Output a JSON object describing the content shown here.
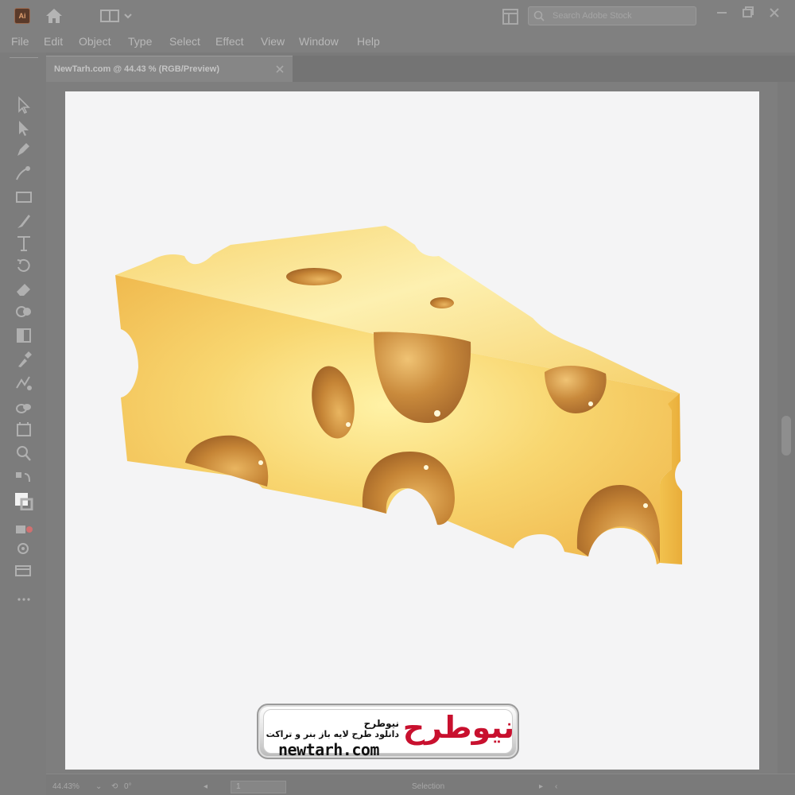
{
  "titlebar": {
    "app_badge": "Ai",
    "search_placeholder": "Search Adobe Stock"
  },
  "menu": [
    "File",
    "Edit",
    "Object",
    "Type",
    "Select",
    "Effect",
    "View",
    "Window",
    "Help"
  ],
  "document_tab": {
    "label": "NewTarh.com @ 44.43 % (RGB/Preview)"
  },
  "tools": [
    "selection-tool-icon",
    "direct-selection-tool-icon",
    "pen-tool-icon",
    "curvature-tool-icon",
    "rectangle-tool-icon",
    "paintbrush-tool-icon",
    "type-tool-icon",
    "rotate-tool-icon",
    "eraser-tool-icon",
    "shape-builder-tool-icon",
    "gradient-tool-icon",
    "eyedropper-tool-icon",
    "blend-tool-icon",
    "symbol-sprayer-tool-icon",
    "artboard-tool-icon",
    "zoom-tool-icon",
    "swap-colors-icon",
    "fill-stroke-icon",
    "draw-mode-icon",
    "screen-mode-icon",
    "edit-toolbar-icon"
  ],
  "status": {
    "zoom": "44.43%",
    "rotation": "0°",
    "artboard": "1",
    "tool": "Selection"
  },
  "watermark": {
    "site": "newtarh.com",
    "title": "نیوطرح",
    "tagline": "دانلود طرح لایه باز بنر و تراکت",
    "logo": "نیوطرح"
  },
  "colors": {
    "cheese_light": "#fbe89a",
    "cheese_mid": "#f6cf62",
    "cheese_dark": "#e7aa3a",
    "hole_shadow": "#a8662a",
    "brand_red": "#c8102e"
  }
}
